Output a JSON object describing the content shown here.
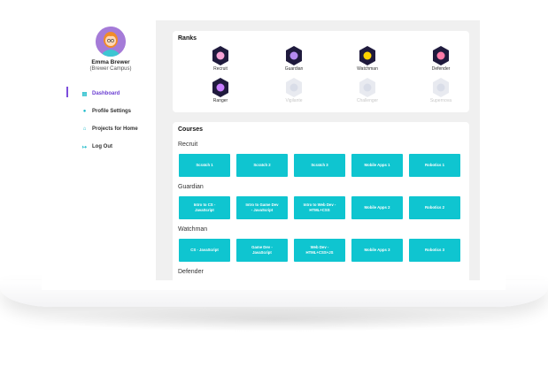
{
  "user": {
    "name": "Emma Brewer",
    "campus": "(Brewer Campus)"
  },
  "nav": [
    {
      "label": "Dashboard",
      "icon": "dashboard-icon",
      "glyph": "▤"
    },
    {
      "label": "Profile Settings",
      "icon": "user-icon",
      "glyph": "●"
    },
    {
      "label": "Projects for Home",
      "icon": "home-icon",
      "glyph": "⌂"
    },
    {
      "label": "Log Out",
      "icon": "logout-icon",
      "glyph": "↦"
    }
  ],
  "ranks": {
    "title": "Ranks",
    "items": [
      {
        "label": "Recruit",
        "locked": false,
        "color": "#f7a3d6"
      },
      {
        "label": "Guardian",
        "locked": false,
        "color": "#b58af0"
      },
      {
        "label": "Watchman",
        "locked": false,
        "color": "#ffd200"
      },
      {
        "label": "Defender",
        "locked": false,
        "color": "#ff7aa8"
      },
      {
        "label": "Ranger",
        "locked": false,
        "color": "#c77dff"
      },
      {
        "label": "Vigilante",
        "locked": true,
        "color": "#d9dde8"
      },
      {
        "label": "Challenger",
        "locked": true,
        "color": "#d9dde8"
      },
      {
        "label": "Supernova",
        "locked": true,
        "color": "#d9dde8"
      }
    ]
  },
  "courses": {
    "title": "Courses",
    "levels": [
      {
        "name": "Recruit",
        "items": [
          "Scratch 1",
          "Scratch 2",
          "Scratch 3",
          "Mobile Apps 1",
          "Robotics 1"
        ]
      },
      {
        "name": "Guardian",
        "items": [
          "Intro to CS -\nJavaScript",
          "Intro to Game Dev\n- JavaScript",
          "Intro to Web Dev -\nHTML+CSS",
          "Mobile Apps 2",
          "Robotics 2"
        ]
      },
      {
        "name": "Watchman",
        "items": [
          "CS - JavaScript",
          "Game Dev -\nJavaScript",
          "Web Dev -\nHTML+CSS+JS",
          "Mobile Apps 3",
          "Robotics 3"
        ]
      },
      {
        "name": "Defender",
        "items": []
      }
    ]
  },
  "colors": {
    "accent": "#7c4ddb",
    "course_button": "#0fc5d0",
    "badge_bg": "#1f1a3d"
  }
}
